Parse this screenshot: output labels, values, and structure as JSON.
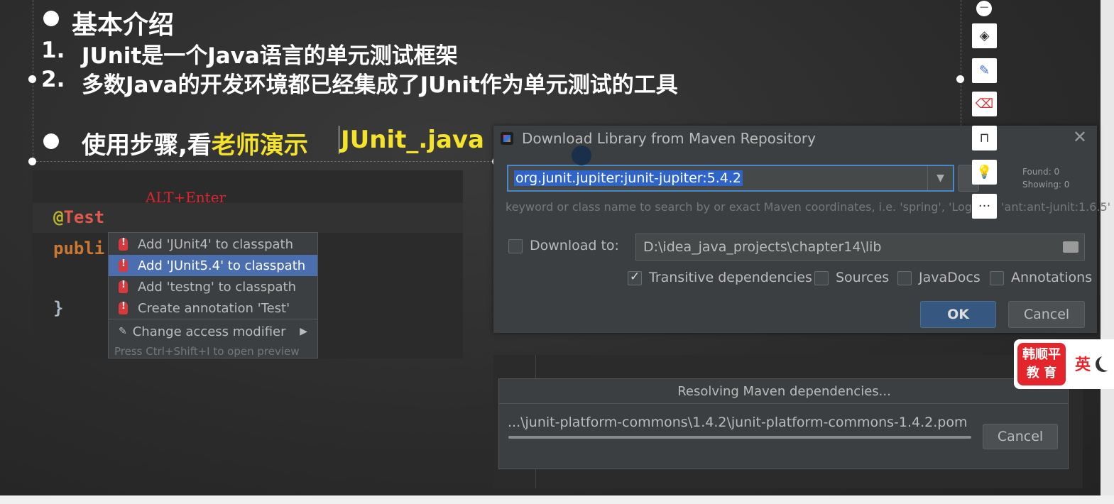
{
  "slide": {
    "heading": "基本介绍",
    "point1_num": "1.",
    "point1": "JUnit是一个Java语言的单元测试框架",
    "point2_num": "2.",
    "point2": "多数Java的开发环境都已经集成了JUnit作为单元测试的工具",
    "usage_prefix": "使用步骤,看",
    "usage_highlight": "老师演示",
    "usage_file": "JUnit_.java"
  },
  "editor": {
    "annotation_note": "ALT+Enter",
    "line1_at": "@",
    "line1_name": "Test",
    "line2": "publi",
    "line3": "}"
  },
  "popup": {
    "items": [
      {
        "label": "Add 'JUnit4' to classpath"
      },
      {
        "label": "Add 'JUnit5.4' to classpath"
      },
      {
        "label": "Add 'testng' to classpath"
      },
      {
        "label": "Create annotation 'Test'"
      },
      {
        "label": "Change access modifier"
      }
    ],
    "hint": "Press Ctrl+Shift+I to open preview"
  },
  "maven_dialog": {
    "title": "Download Library from Maven Repository",
    "search_value": "org.junit.jupiter:junit-jupiter:5.4.2",
    "found": "Found: 0",
    "showing": "Showing: 0",
    "hint": "keyword or class name to search by or exact Maven coordinates, i.e. 'spring', 'Logger', 'ant:ant-junit:1.6.5'",
    "download_to_label": "Download to:",
    "download_path": "D:\\idea_java_projects\\chapter14\\lib",
    "transitive_label": "Transitive dependencies",
    "sources_label": "Sources",
    "javadocs_label": "JavaDocs",
    "annotations_label": "Annotations",
    "ok_label": "OK",
    "cancel_label": "Cancel"
  },
  "resolving_dialog": {
    "title": "Resolving Maven dependencies...",
    "path": "...\\junit-platform-commons\\1.4.2\\junit-platform-commons-1.4.2.pom",
    "progress": 1.0,
    "cancel_label": "Cancel"
  },
  "logo": {
    "line1": "韩顺平",
    "line2": "教 育",
    "lang": "英"
  },
  "toolbar": {
    "more": "···"
  }
}
